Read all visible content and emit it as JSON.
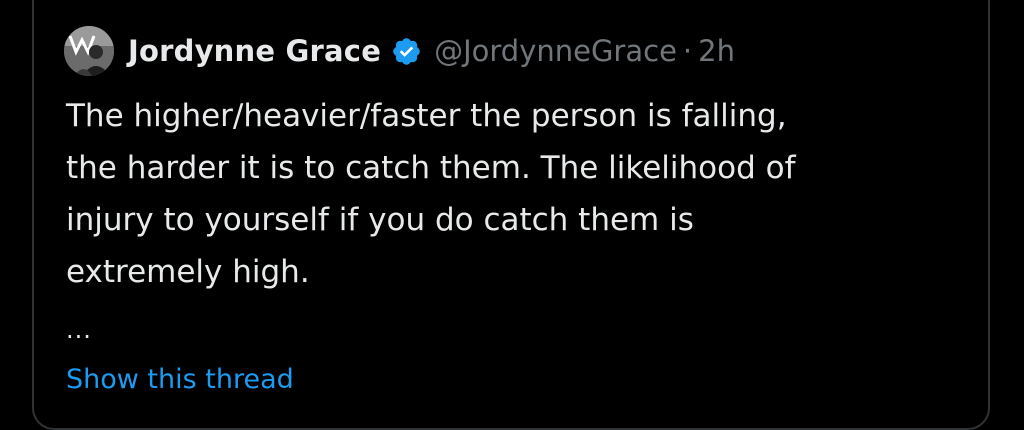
{
  "tweet": {
    "author": {
      "display_name": "Jordynne Grace",
      "handle": "@JordynneGrace",
      "verified_icon": "verified-badge-icon",
      "avatar_icon": "avatar"
    },
    "separator": "·",
    "timestamp": "2h",
    "text": "The higher/heavier/faster the person is falling,\nthe harder it is to catch them. The likelihood of\ninjury to yourself if you do catch them is\nextremely high.",
    "ellipsis": "...",
    "show_thread_label": "Show this thread"
  },
  "colors": {
    "background": "#000000",
    "text_primary": "#e7e9ea",
    "text_secondary": "#71767b",
    "link": "#1d9bf0",
    "verified": "#1d9bf0",
    "border": "#2f3336"
  }
}
